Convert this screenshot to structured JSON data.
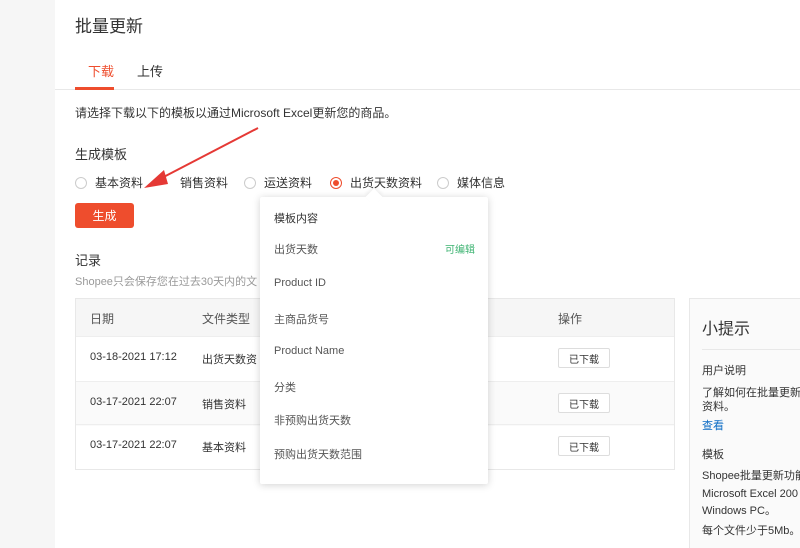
{
  "page": {
    "title": "批量更新"
  },
  "tabs": [
    {
      "label": "下载",
      "active": true
    },
    {
      "label": "上传",
      "active": false
    }
  ],
  "description": "请选择下载以下的模板以通过Microsoft Excel更新您的商品。",
  "template_section": {
    "label": "生成模板",
    "options": [
      {
        "label": "基本资料",
        "checked": false
      },
      {
        "label": "销售资料",
        "checked": false
      },
      {
        "label": "运送资料",
        "checked": false
      },
      {
        "label": "出货天数资料",
        "checked": true
      },
      {
        "label": "媒体信息",
        "checked": false
      }
    ],
    "generate_button": "生成"
  },
  "records": {
    "label": "记录",
    "hint": "Shopee只会保存您在过去30天内的文",
    "columns": {
      "date": "日期",
      "file_type": "文件类型",
      "action": "操作"
    },
    "rows": [
      {
        "date": "03-18-2021 17:12",
        "file_type": "出货天数资",
        "action": "已下载"
      },
      {
        "date": "03-17-2021 22:07",
        "file_type": "销售资料",
        "action": "已下载"
      },
      {
        "date": "03-17-2021 22:07",
        "file_type": "基本资料",
        "action": "已下载"
      }
    ]
  },
  "popover": {
    "header": "模板内容",
    "editable_tag": "可编辑",
    "items": [
      "出货天数",
      "Product ID",
      "主商品货号",
      "Product Name",
      "分类",
      "非预购出货天数",
      "预购出货天数范围"
    ]
  },
  "tips": {
    "title": "小提示",
    "user_guide_label": "用户说明",
    "user_guide_line1": "了解如何在批量更新",
    "user_guide_line2": "资料。",
    "view_link": "查看",
    "template_label": "模板",
    "template_line1": "Shopee批量更新功能",
    "template_line2": "Microsoft Excel 200",
    "template_line3": "Windows PC。",
    "template_line4": "每个文件少于5Mb。"
  },
  "colors": {
    "accent": "#ee4d2d",
    "link": "#0b6bc4",
    "editable": "#3cb371"
  },
  "icons": {
    "annotation": "red-arrow-icon"
  }
}
